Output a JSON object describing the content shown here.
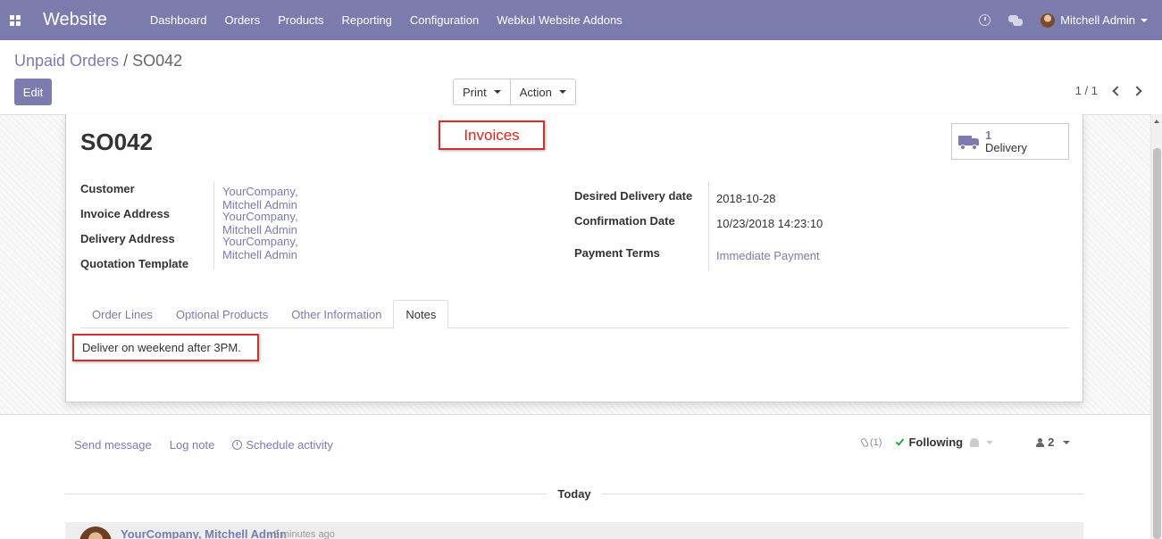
{
  "navbar": {
    "app_name": "Website",
    "menu": [
      "Dashboard",
      "Orders",
      "Products",
      "Reporting",
      "Configuration",
      "Webkul Website Addons"
    ],
    "user_name": "Mitchell Admin",
    "color": "#7c7bad"
  },
  "breadcrumb": {
    "parent": "Unpaid Orders",
    "separator": "/",
    "current": "SO042"
  },
  "control": {
    "edit_label": "Edit",
    "print_label": "Print",
    "action_label": "Action",
    "pager": "1 / 1"
  },
  "order": {
    "name": "SO042",
    "annotation_label": "Invoices",
    "delivery": {
      "count": "1",
      "label": "Delivery"
    },
    "left_labels": [
      "Customer",
      "Invoice Address",
      "Delivery Address",
      "Quotation Template"
    ],
    "left_values": [
      "YourCompany, Mitchell Admin",
      "YourCompany, Mitchell Admin",
      "YourCompany, Mitchell Admin",
      ""
    ],
    "right_labels": [
      "Desired Delivery date",
      "Confirmation Date",
      "Payment Terms"
    ],
    "right_values": [
      "2018-10-28",
      "10/23/2018 14:23:10",
      "Immediate Payment"
    ],
    "tabs": [
      "Order Lines",
      "Optional Products",
      "Other Information",
      "Notes"
    ],
    "active_tab": "Notes",
    "note": "Deliver on weekend after 3PM."
  },
  "chatter": {
    "send_message": "Send message",
    "log_note": "Log note",
    "schedule_activity": "Schedule activity",
    "attachments": "(1)",
    "following": "Following",
    "followers": "2",
    "day_label": "Today",
    "message_author": "YourCompany, Mitchell Admin",
    "message_time": "- 3 minutes ago"
  }
}
